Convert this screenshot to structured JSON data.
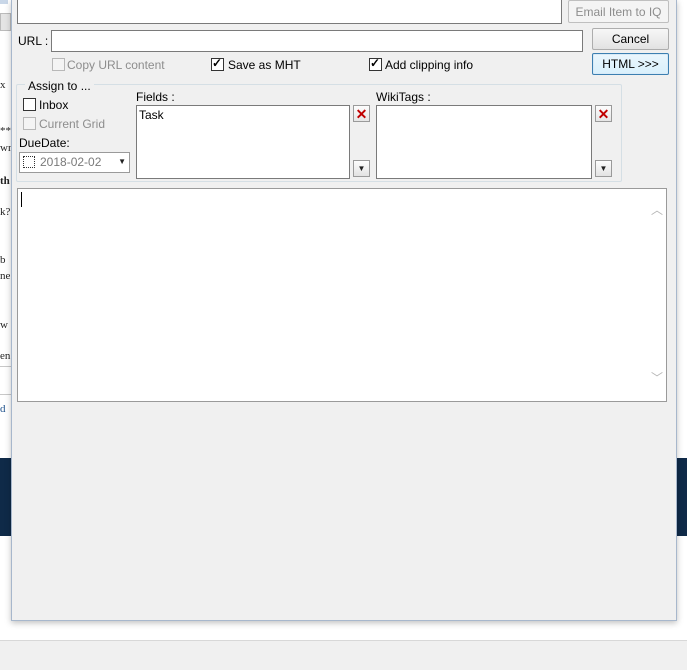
{
  "background": {
    "fragments": [
      "x",
      "**",
      "wr",
      "th",
      "k?",
      "b",
      "ne",
      "w",
      "en",
      "d"
    ]
  },
  "toolbar": {
    "email_item_label": "Email Item to IQ",
    "cancel_label": "Cancel",
    "html_label": "HTML >>>"
  },
  "url": {
    "label": "URL :",
    "value": "",
    "copy_url_content_label": "Copy URL content",
    "copy_url_content_checked": false,
    "save_as_mht_label": "Save as MHT",
    "save_as_mht_checked": true,
    "add_clipping_info_label": "Add clipping info",
    "add_clipping_info_checked": true
  },
  "assign": {
    "group_title": "Assign to ...",
    "inbox_label": "Inbox",
    "inbox_checked": false,
    "current_grid_label": "Current Grid",
    "current_grid_checked": false,
    "due_date_label": "DueDate:",
    "due_date_value": "2018-02-02",
    "due_date_checked": false
  },
  "fields": {
    "label": "Fields :",
    "items": [
      "Task"
    ]
  },
  "wikitags": {
    "label": "WikiTags :",
    "items": []
  },
  "body_text": ""
}
